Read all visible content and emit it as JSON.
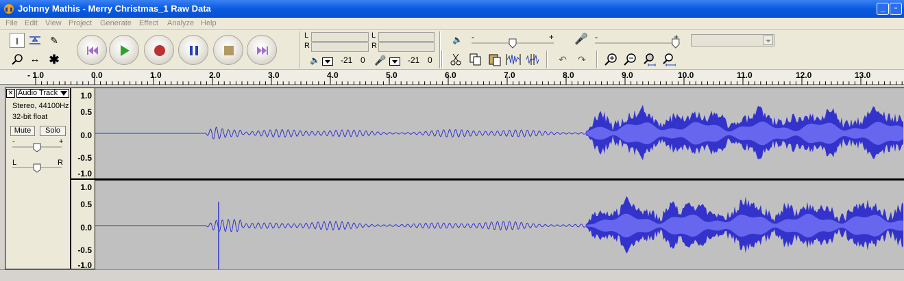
{
  "window": {
    "title": "Johnny Mathis - Merry Christmas_1 Raw Data"
  },
  "menu": {
    "items": [
      "File",
      "Edit",
      "View",
      "Project",
      "Generate",
      "Effect",
      "Analyze",
      "Help"
    ]
  },
  "meters": {
    "play": {
      "l": "L",
      "r": "R",
      "db": "-21",
      "zero": "0"
    },
    "rec": {
      "l": "L",
      "r": "R",
      "db": "-21",
      "zero": "0"
    }
  },
  "mixer": {
    "minus1": "-",
    "plus1": "+",
    "minus2": "-",
    "plus2": "+",
    "output_volume": 0.5,
    "input_volume": 0.95
  },
  "ruler": {
    "ticks": [
      "- 1.0",
      "0.0",
      "1.0",
      "2.0",
      "3.0",
      "4.0",
      "5.0",
      "6.0",
      "7.0",
      "8.0",
      "9.0",
      "10.0",
      "11.0",
      "12.0",
      "13.0"
    ]
  },
  "track": {
    "name": "Audio Track",
    "info1": "Stereo, 44100Hz",
    "info2": "32-bit float",
    "mute": "Mute",
    "solo": "Solo",
    "gain_minus": "-",
    "gain_plus": "+",
    "pan_left": "L",
    "pan_right": "R",
    "vticks": [
      "1.0",
      "0.5",
      "0.0",
      "-0.5",
      "-1.0"
    ]
  },
  "colors": {
    "wave": "#3333cc",
    "wave_light": "#6666ee",
    "wave_bg": "#c0c0c0",
    "title_bar": "#0a5ae0"
  },
  "icons": [
    "selection-tool-icon",
    "envelope-tool-icon",
    "draw-tool-icon",
    "zoom-tool-icon",
    "timeshift-tool-icon",
    "multi-tool-icon",
    "skip-start-icon",
    "play-icon",
    "record-icon",
    "pause-icon",
    "stop-icon",
    "skip-end-icon",
    "speaker-icon",
    "microphone-icon",
    "cut-icon",
    "copy-icon",
    "paste-icon",
    "trim-icon",
    "silence-icon",
    "undo-icon",
    "redo-icon",
    "zoom-in-icon",
    "zoom-out-icon",
    "fit-selection-icon",
    "fit-project-icon"
  ]
}
